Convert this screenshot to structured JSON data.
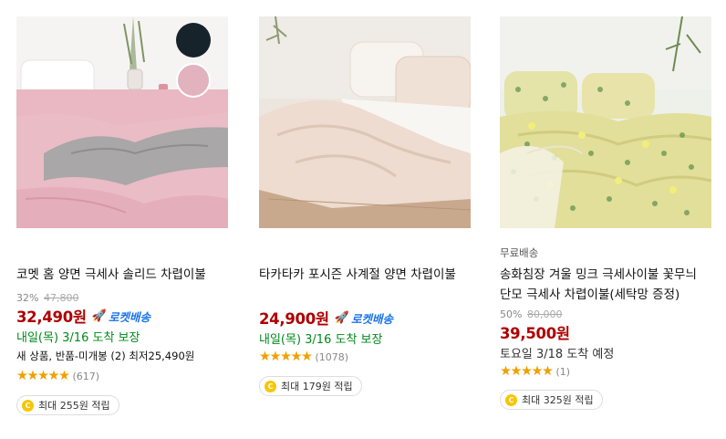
{
  "products": [
    {
      "badge": "",
      "title": "코멧 홈 양면 극세사 솔리드 차렵이불",
      "discount": "32%",
      "original_price": "47,800",
      "price": "32,490원",
      "rocket_label": "로켓배송",
      "arrival": "내일(목) 3/16 도착 보장",
      "extra": "새 상품, 반품-미개봉 (2) 최저25,490원",
      "rating": 4.5,
      "stars": "★★★★★",
      "review_count": "(617)",
      "reward": "최대 255원 적립",
      "image_icon": "pink-gray-comforter-photo"
    },
    {
      "badge": "",
      "title": "타카타카 포시즌 사계절 양면 차렵이불",
      "discount": "",
      "original_price": "",
      "price": "24,900원",
      "rocket_label": "로켓배송",
      "arrival": "내일(목) 3/16 도착 보장",
      "extra": "",
      "rating": 4.5,
      "stars": "★★★★★",
      "review_count": "(1078)",
      "reward": "최대 179원 적립",
      "image_icon": "beige-comforter-photo"
    },
    {
      "badge": "무료배송",
      "title": "송화침장 겨울 밍크 극세사이불 꽃무늬 단모 극세사 차렵이불(세탁망 증정)",
      "discount": "50%",
      "original_price": "80,000",
      "price": "39,500원",
      "rocket_label": "",
      "arrival": "토요일 3/18 도착 예정",
      "extra": "",
      "rating": 5,
      "stars": "★★★★★",
      "review_count": "(1)",
      "reward": "최대 325원 적립",
      "image_icon": "yellow-floral-comforter-photo"
    }
  ],
  "colors": {
    "price": "#ae0000",
    "rocket": "#1a73e8",
    "arrival_guaranteed": "#00891a",
    "star": "#f1a000",
    "coin": "#f7c600"
  }
}
